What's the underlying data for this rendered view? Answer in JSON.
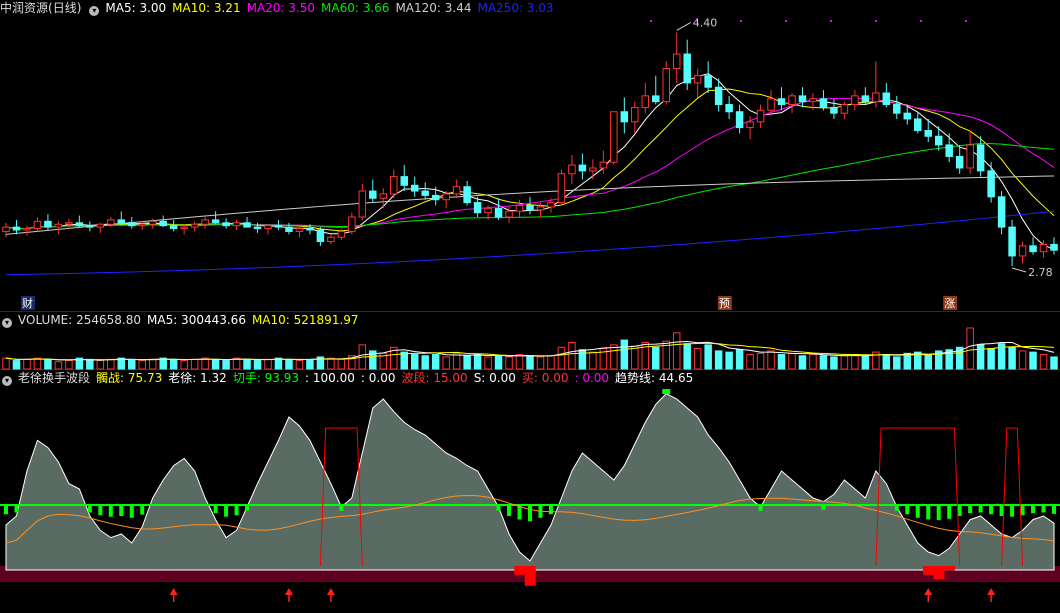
{
  "colors": {
    "up": "#ff3232",
    "down": "#54fcfc",
    "ma5": "#ffffff",
    "ma10": "#ffff00",
    "ma20": "#ff00ff",
    "ma60": "#00e600",
    "ma120": "#cccccc",
    "ma250": "#2020ff",
    "vma5": "#ffffff",
    "vma10": "#ffff00",
    "mountain": "#5a6b63",
    "green_bar": "#00ff00",
    "red_fill": "#ff0000",
    "band": "#600020",
    "arrow": "#ff2020",
    "grid": "#8b0000"
  },
  "price_panel": {
    "stock_name": "中润资源",
    "period": "(日线)",
    "indicators": [
      {
        "label": "MA5: 3.00",
        "color": "#ffffff"
      },
      {
        "label": "MA10: 3.21",
        "color": "#ffff00"
      },
      {
        "label": "MA20: 3.50",
        "color": "#ff00ff"
      },
      {
        "label": "MA60: 3.66",
        "color": "#00e600"
      },
      {
        "label": "MA120: 3.44",
        "color": "#cccccc"
      },
      {
        "label": "MA250: 3.03",
        "color": "#2020ff"
      }
    ],
    "high_label": "4.40",
    "low_label": "2.78",
    "events": [
      {
        "text": "财",
        "pos": 0.02
      },
      {
        "text": "预",
        "pos": 0.685
      },
      {
        "text": "涨",
        "pos": 0.9
      }
    ]
  },
  "volume_panel": {
    "title": "VOLUME: 254658.80",
    "ma5": "MA5: 300443.66",
    "ma10": "MA10: 521891.97"
  },
  "indicator_panel": {
    "title": "老徐换手波段",
    "values": [
      {
        "label": "髑战: 75.73",
        "color": "#ffff00"
      },
      {
        "label": "老徐: 1.32",
        "color": "#ffffff"
      },
      {
        "label": "切手: 93.93",
        "color": "#00ff00"
      },
      {
        "label": ": 100.00",
        "color": "#ffffff"
      },
      {
        "label": ": 0.00",
        "color": "#ffffff"
      },
      {
        "label": "波段: 15.00",
        "color": "#ff3232"
      },
      {
        "label": "S: 0.00",
        "color": "#ffffff"
      },
      {
        "label": "买: 0.00",
        "color": "#ff3232"
      },
      {
        "label": ": 0.00",
        "color": "#ff00ff"
      },
      {
        "label": "趋势线: 44.65",
        "color": "#ffffff"
      }
    ]
  },
  "chart_data": {
    "type": "candlestick",
    "note_units": "price in CNY",
    "ylim": [
      2.6,
      4.5
    ],
    "candles": [
      [
        3.02,
        3.08,
        2.98,
        3.05
      ],
      [
        3.05,
        3.1,
        3.0,
        3.03
      ],
      [
        3.03,
        3.06,
        2.99,
        3.04
      ],
      [
        3.04,
        3.12,
        3.02,
        3.09
      ],
      [
        3.09,
        3.14,
        3.03,
        3.05
      ],
      [
        3.05,
        3.09,
        3.0,
        3.07
      ],
      [
        3.07,
        3.11,
        3.04,
        3.08
      ],
      [
        3.08,
        3.13,
        3.05,
        3.06
      ],
      [
        3.06,
        3.09,
        3.02,
        3.05
      ],
      [
        3.05,
        3.08,
        3.01,
        3.07
      ],
      [
        3.07,
        3.12,
        3.05,
        3.1
      ],
      [
        3.1,
        3.16,
        3.06,
        3.08
      ],
      [
        3.08,
        3.12,
        3.04,
        3.06
      ],
      [
        3.06,
        3.09,
        3.03,
        3.07
      ],
      [
        3.07,
        3.11,
        3.04,
        3.09
      ],
      [
        3.09,
        3.13,
        3.05,
        3.06
      ],
      [
        3.06,
        3.1,
        3.02,
        3.04
      ],
      [
        3.04,
        3.07,
        3.0,
        3.05
      ],
      [
        3.05,
        3.09,
        3.02,
        3.07
      ],
      [
        3.07,
        3.12,
        3.04,
        3.1
      ],
      [
        3.1,
        3.16,
        3.07,
        3.08
      ],
      [
        3.08,
        3.11,
        3.04,
        3.06
      ],
      [
        3.06,
        3.1,
        3.03,
        3.08
      ],
      [
        3.08,
        3.12,
        3.05,
        3.05
      ],
      [
        3.05,
        3.08,
        3.01,
        3.04
      ],
      [
        3.04,
        3.07,
        3.0,
        3.06
      ],
      [
        3.06,
        3.1,
        3.03,
        3.05
      ],
      [
        3.05,
        3.08,
        3.0,
        3.02
      ],
      [
        3.02,
        3.05,
        2.98,
        3.04
      ],
      [
        3.04,
        3.07,
        3.0,
        3.03
      ],
      [
        3.03,
        3.05,
        2.92,
        2.95
      ],
      [
        2.95,
        3.0,
        2.93,
        2.98
      ],
      [
        2.98,
        3.04,
        2.96,
        3.02
      ],
      [
        3.02,
        3.15,
        3.0,
        3.12
      ],
      [
        3.12,
        3.35,
        3.1,
        3.3
      ],
      [
        3.3,
        3.38,
        3.22,
        3.25
      ],
      [
        3.25,
        3.32,
        3.18,
        3.28
      ],
      [
        3.28,
        3.45,
        3.25,
        3.4
      ],
      [
        3.4,
        3.48,
        3.3,
        3.34
      ],
      [
        3.34,
        3.4,
        3.26,
        3.3
      ],
      [
        3.3,
        3.36,
        3.24,
        3.27
      ],
      [
        3.27,
        3.33,
        3.2,
        3.24
      ],
      [
        3.24,
        3.3,
        3.18,
        3.28
      ],
      [
        3.28,
        3.38,
        3.25,
        3.33
      ],
      [
        3.33,
        3.37,
        3.2,
        3.22
      ],
      [
        3.22,
        3.26,
        3.12,
        3.15
      ],
      [
        3.15,
        3.2,
        3.1,
        3.18
      ],
      [
        3.18,
        3.25,
        3.1,
        3.12
      ],
      [
        3.12,
        3.2,
        3.08,
        3.16
      ],
      [
        3.16,
        3.24,
        3.12,
        3.2
      ],
      [
        3.2,
        3.26,
        3.14,
        3.17
      ],
      [
        3.17,
        3.22,
        3.12,
        3.19
      ],
      [
        3.19,
        3.25,
        3.15,
        3.22
      ],
      [
        3.22,
        3.45,
        3.2,
        3.42
      ],
      [
        3.42,
        3.55,
        3.35,
        3.48
      ],
      [
        3.48,
        3.56,
        3.38,
        3.44
      ],
      [
        3.44,
        3.52,
        3.38,
        3.46
      ],
      [
        3.46,
        3.58,
        3.42,
        3.5
      ],
      [
        3.5,
        3.7,
        3.48,
        3.85
      ],
      [
        3.85,
        3.95,
        3.7,
        3.78
      ],
      [
        3.78,
        3.92,
        3.7,
        3.88
      ],
      [
        3.88,
        4.05,
        3.84,
        3.96
      ],
      [
        3.96,
        4.1,
        3.9,
        3.92
      ],
      [
        3.92,
        4.2,
        3.9,
        4.15
      ],
      [
        4.15,
        4.4,
        4.05,
        4.25
      ],
      [
        4.25,
        4.35,
        4.0,
        4.05
      ],
      [
        4.05,
        4.15,
        3.95,
        4.1
      ],
      [
        4.1,
        4.2,
        3.98,
        4.02
      ],
      [
        4.02,
        4.08,
        3.85,
        3.9
      ],
      [
        3.9,
        3.96,
        3.8,
        3.85
      ],
      [
        3.85,
        3.9,
        3.7,
        3.74
      ],
      [
        3.74,
        3.82,
        3.66,
        3.78
      ],
      [
        3.78,
        3.9,
        3.74,
        3.86
      ],
      [
        3.86,
        4.0,
        3.82,
        3.94
      ],
      [
        3.94,
        4.02,
        3.86,
        3.9
      ],
      [
        3.9,
        3.98,
        3.84,
        3.96
      ],
      [
        3.96,
        4.02,
        3.88,
        3.92
      ],
      [
        3.92,
        3.98,
        3.86,
        3.94
      ],
      [
        3.94,
        4.0,
        3.86,
        3.88
      ],
      [
        3.88,
        3.94,
        3.8,
        3.84
      ],
      [
        3.84,
        3.92,
        3.8,
        3.9
      ],
      [
        3.9,
        4.0,
        3.86,
        3.96
      ],
      [
        3.96,
        4.02,
        3.9,
        3.92
      ],
      [
        3.92,
        4.2,
        3.88,
        3.98
      ],
      [
        3.98,
        4.05,
        3.88,
        3.9
      ],
      [
        3.9,
        3.96,
        3.8,
        3.84
      ],
      [
        3.84,
        3.9,
        3.76,
        3.8
      ],
      [
        3.8,
        3.85,
        3.7,
        3.72
      ],
      [
        3.72,
        3.8,
        3.64,
        3.68
      ],
      [
        3.68,
        3.75,
        3.58,
        3.62
      ],
      [
        3.62,
        3.7,
        3.5,
        3.54
      ],
      [
        3.54,
        3.62,
        3.42,
        3.46
      ],
      [
        3.46,
        3.72,
        3.42,
        3.62
      ],
      [
        3.62,
        3.68,
        3.4,
        3.44
      ],
      [
        3.44,
        3.5,
        3.22,
        3.26
      ],
      [
        3.26,
        3.3,
        3.0,
        3.05
      ],
      [
        3.05,
        3.1,
        2.78,
        2.85
      ],
      [
        2.85,
        2.95,
        2.8,
        2.92
      ],
      [
        2.92,
        2.98,
        2.86,
        2.88
      ],
      [
        2.88,
        2.96,
        2.84,
        2.93
      ],
      [
        2.93,
        2.98,
        2.86,
        2.89
      ]
    ],
    "volumes": [
      9,
      7,
      8,
      9,
      8,
      6,
      7,
      9,
      8,
      7,
      8,
      9,
      8,
      7,
      8,
      9,
      8,
      7,
      8,
      9,
      8,
      7,
      9,
      8,
      7,
      8,
      9,
      8,
      7,
      8,
      10,
      9,
      8,
      11,
      20,
      15,
      13,
      18,
      14,
      12,
      11,
      12,
      10,
      13,
      11,
      12,
      10,
      11,
      10,
      12,
      11,
      10,
      11,
      18,
      22,
      16,
      14,
      17,
      20,
      24,
      19,
      22,
      18,
      23,
      30,
      21,
      17,
      20,
      15,
      14,
      16,
      12,
      13,
      15,
      12,
      13,
      11,
      12,
      11,
      10,
      11,
      12,
      11,
      14,
      12,
      10,
      13,
      14,
      12,
      15,
      16,
      18,
      34,
      20,
      17,
      21,
      18,
      15,
      14,
      12,
      10
    ],
    "oscillator": [
      25,
      30,
      55,
      72,
      68,
      60,
      48,
      45,
      30,
      22,
      18,
      20,
      15,
      24,
      40,
      50,
      58,
      62,
      55,
      40,
      28,
      18,
      22,
      35,
      48,
      60,
      72,
      85,
      80,
      72,
      60,
      48,
      35,
      40,
      65,
      90,
      95,
      88,
      82,
      78,
      75,
      70,
      65,
      62,
      58,
      55,
      45,
      35,
      20,
      10,
      5,
      15,
      25,
      40,
      55,
      65,
      60,
      55,
      50,
      58,
      70,
      82,
      92,
      98,
      95,
      90,
      85,
      75,
      68,
      60,
      50,
      40,
      35,
      45,
      55,
      50,
      45,
      40,
      38,
      42,
      50,
      45,
      40,
      55,
      48,
      35,
      25,
      15,
      10,
      8,
      12,
      20,
      28,
      30,
      25,
      20,
      18,
      22,
      28,
      30,
      26
    ]
  }
}
